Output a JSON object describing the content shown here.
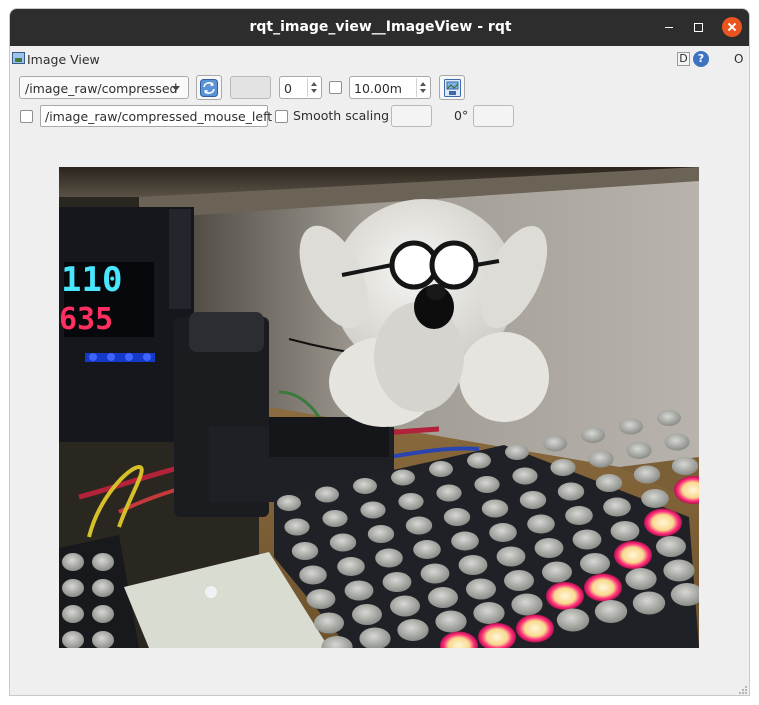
{
  "window": {
    "title": "rqt_image_view__ImageView - rqt"
  },
  "panel": {
    "title": "Image View",
    "d_label": "D",
    "help_label": "?",
    "close_label": "O"
  },
  "toolbar": {
    "topic": "/image_raw/compressed",
    "index_value": "0",
    "index_checked": false,
    "distance_value": "10.00m"
  },
  "row2": {
    "publish_enabled": false,
    "mouse_topic": "/image_raw/compressed_mouse_left",
    "smooth_scaling_checked": false,
    "smooth_scaling_label": "Smooth scaling",
    "rotation_label": "0°"
  },
  "image": {
    "display": {
      "upper_text": "110",
      "lower_text": "635",
      "upper_color": "#48e7ff",
      "lower_color": "#ff3060"
    },
    "led_color": "#ff2d7a"
  },
  "icons": {
    "window_icon": "image-icon",
    "refresh": "refresh-icon",
    "save": "save-image-icon"
  }
}
